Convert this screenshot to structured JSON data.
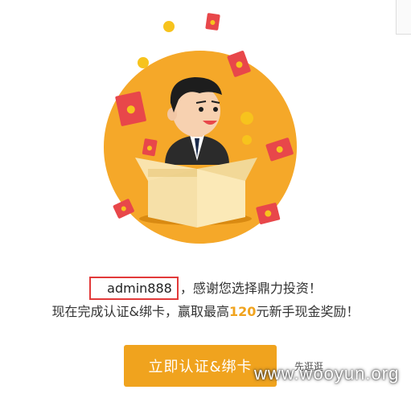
{
  "hero": {
    "illustration": "businessman-in-box-red-envelopes"
  },
  "message": {
    "username": "admin888",
    "separator": "，",
    "line1_rest": "感谢您选择鼎力投资！",
    "line2_prefix": "现在完成认证&绑卡，赢取最高",
    "line2_amount": "120",
    "line2_suffix": "元新手现金奖励！"
  },
  "actions": {
    "primary_label": "立即认证&绑卡",
    "secondary_label": "先逛逛"
  },
  "watermark": "www.wooyun.org",
  "colors": {
    "orange_circle": "#f5a623",
    "button": "#f0a31e",
    "highlight": "#f0a31e",
    "red_envelope": "#e8474a",
    "username_box_border": "#e23a3a"
  }
}
